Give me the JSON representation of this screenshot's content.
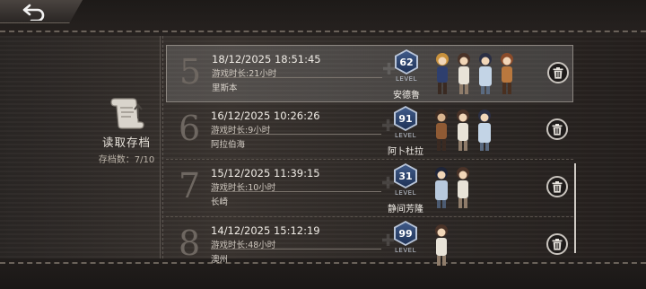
{
  "header": {
    "back_icon": "return-arrow-icon"
  },
  "save_panel": {
    "icon": "scroll-save-icon",
    "title": "读取存档",
    "count": "存档数：7/10"
  },
  "slots": [
    {
      "number": "5",
      "datetime": "18/12/2025 18:51:45",
      "playtime": "游戏时长:21小时",
      "location": "里斯本",
      "level": "62",
      "level_label": "LEVEL",
      "leader": "安德鲁",
      "party_size": 4,
      "selected": true
    },
    {
      "number": "6",
      "datetime": "16/12/2025 10:26:26",
      "playtime": "游戏时长:9小时",
      "location": "阿拉伯海",
      "level": "91",
      "level_label": "LEVEL",
      "leader": "阿卜杜拉",
      "party_size": 3,
      "selected": false
    },
    {
      "number": "7",
      "datetime": "15/12/2025 11:39:15",
      "playtime": "游戏时长:10小时",
      "location": "长崎",
      "level": "31",
      "level_label": "LEVEL",
      "leader": "静间芳隆",
      "party_size": 2,
      "selected": false
    },
    {
      "number": "8",
      "datetime": "14/12/2025 15:12:19",
      "playtime": "游戏时长:48小时",
      "location": "澳州",
      "level": "99",
      "level_label": "LEVEL",
      "leader": "",
      "party_size": 1,
      "selected": false
    }
  ],
  "colors": {
    "accent_badge": "#2c4470",
    "row_selected": "#7f7b78",
    "text_light": "#e6e2da"
  }
}
